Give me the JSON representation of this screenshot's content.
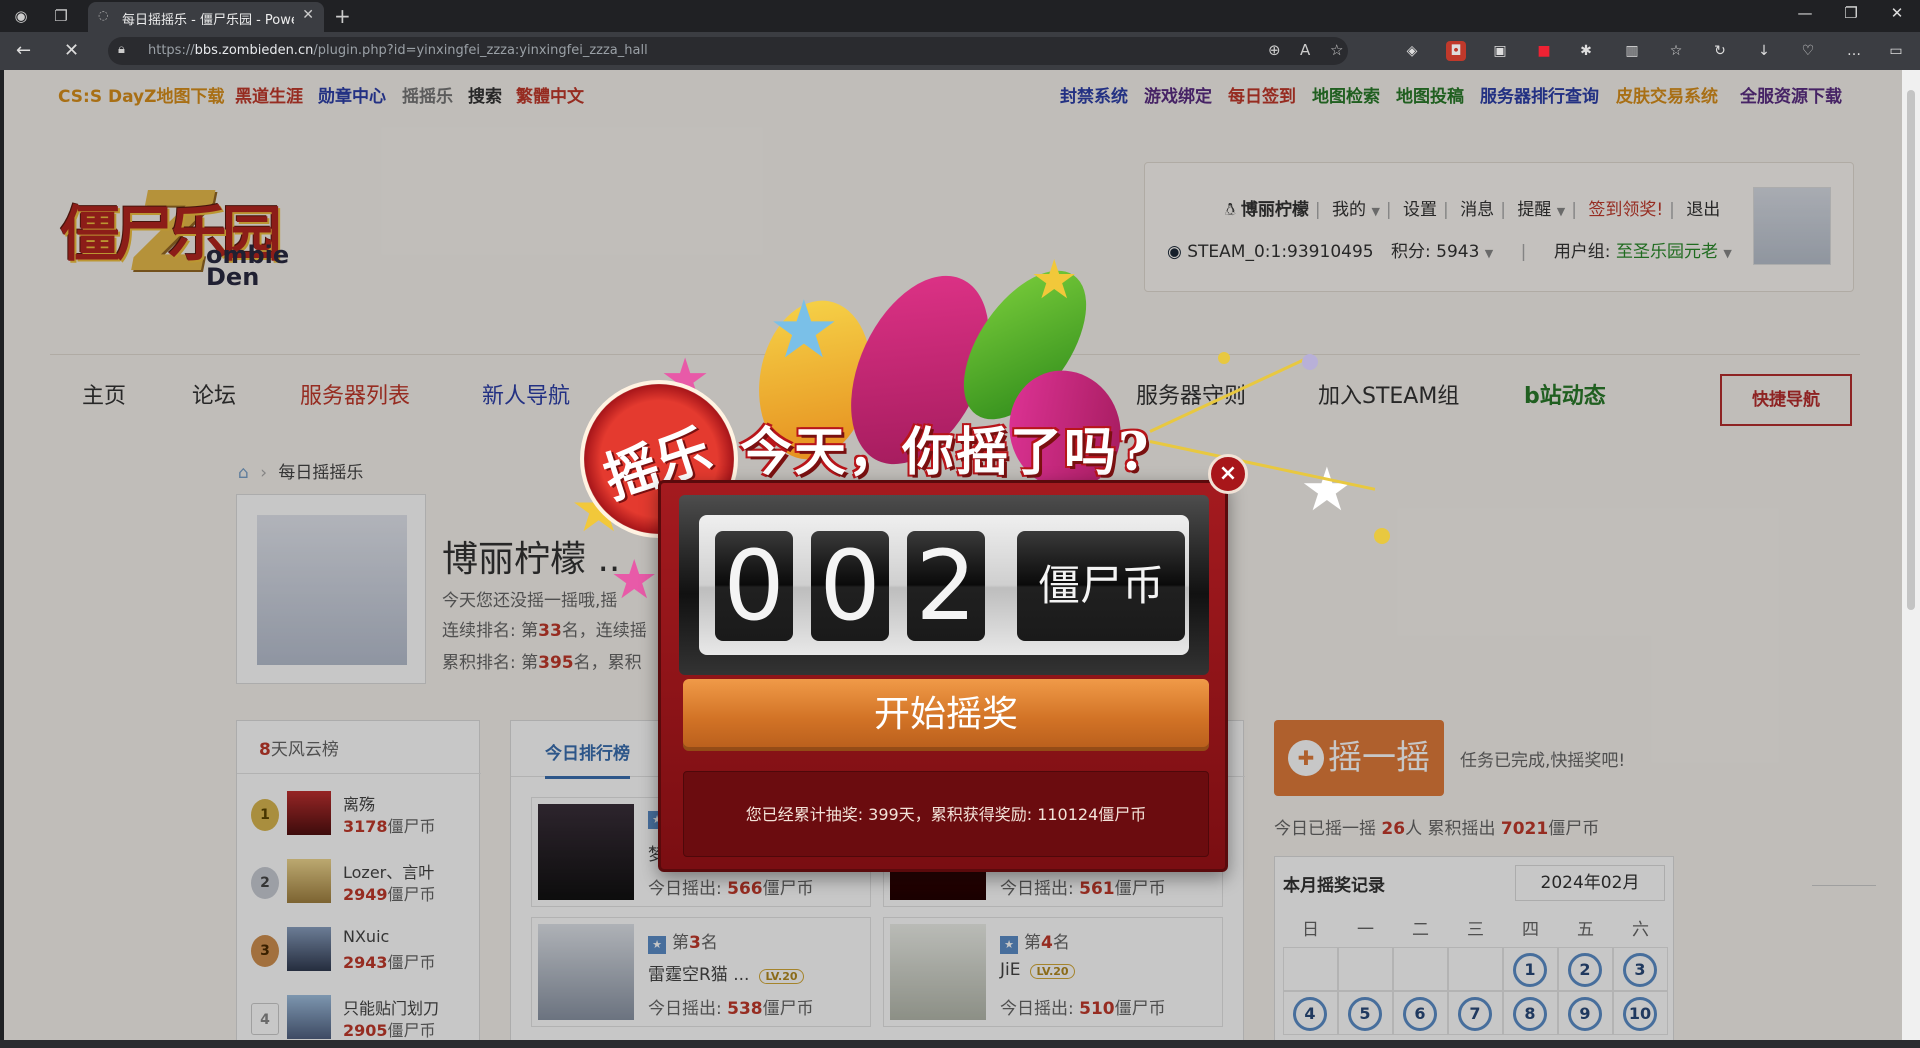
{
  "browser": {
    "tab_title": "每日摇摇乐 - 僵尸乐园 - Powere",
    "url_prefix": "https://",
    "url_domain": "bbs.zombieden.cn",
    "url_path": "/plugin.php?id=yinxingfei_zzza:yinxingfei_zzza_hall"
  },
  "topnav": {
    "left": [
      {
        "label": "CS:S DayZ地图下载",
        "color": "#d88f1b"
      },
      {
        "label": "黑道生涯",
        "color": "#c0392b"
      },
      {
        "label": "勋章中心",
        "color": "#2d3fa8"
      },
      {
        "label": "摇摇乐",
        "color": "#777777"
      },
      {
        "label": "搜索",
        "color": "#333333"
      },
      {
        "label": "繁體中文",
        "color": "#c0392b"
      }
    ],
    "right": [
      {
        "label": "封禁系统",
        "color": "#2d3fa8"
      },
      {
        "label": "游戏绑定",
        "color": "#5a2d82"
      },
      {
        "label": "每日签到",
        "color": "#c0392b"
      },
      {
        "label": "地图检索",
        "color": "#2a7a2a"
      },
      {
        "label": "地图投稿",
        "color": "#2a7a2a"
      },
      {
        "label": "服务器排行查询",
        "color": "#2d3fa8"
      },
      {
        "label": "皮肤交易系统",
        "color": "#d88f1b"
      },
      {
        "label": "全服资源下载",
        "color": "#5a2d82"
      }
    ]
  },
  "logo": {
    "cn": "僵尸乐园",
    "z": "Z",
    "en_line1": "ombie",
    "en_line2": "Den"
  },
  "user": {
    "name": "博丽柠檬",
    "my": "我的",
    "settings": "设置",
    "messages": "消息",
    "remind": "提醒",
    "signin": "签到领奖!",
    "logout": "退出",
    "steam_id": "STEAM_0:1:93910495",
    "points_label": "积分:",
    "points": "5943",
    "group_label": "用户组:",
    "group": "至圣乐园元老"
  },
  "mainnav": {
    "items": [
      {
        "label": "主页",
        "color": "#333333"
      },
      {
        "label": "论坛",
        "color": "#333333"
      },
      {
        "label": "服务器列表",
        "color": "#c0392b"
      },
      {
        "label": "新人导航",
        "color": "#2d3fa8"
      },
      {
        "label": "服务器守则",
        "color": "#333333"
      },
      {
        "label": "加入STEAM组",
        "color": "#333333"
      },
      {
        "label": "b站动态",
        "color": "#2a7a2a"
      }
    ],
    "quick_nav": "快捷导航"
  },
  "breadcrumb": {
    "current": "每日摇摇乐"
  },
  "profile": {
    "name": "博丽柠檬 ..",
    "line1": "今天您还没摇一摇哦,摇",
    "line2_prefix": "连续排名: 第",
    "line2_num": "33",
    "line2_suffix": "名，连续摇",
    "line3_prefix": "累积排名: 第",
    "line3_num": "395",
    "line3_suffix": "名，累积"
  },
  "leaderboard": {
    "title_num": "8",
    "title_rest": "天风云榜",
    "items": [
      {
        "rank": "1",
        "name": "离殇",
        "value": "3178",
        "unit": "僵尸币"
      },
      {
        "rank": "2",
        "name": "Lozer、言叶",
        "value": "2949",
        "unit": "僵尸币"
      },
      {
        "rank": "3",
        "name": "NXuic",
        "value": "2943",
        "unit": "僵尸币"
      },
      {
        "rank": "4",
        "name": "只能贴门划刀",
        "value": "2905",
        "unit": "僵尸币"
      }
    ]
  },
  "today": {
    "tab": "今日排行榜",
    "out_label": "今日摇出:",
    "unit": "僵尸币",
    "rank_prefix": "第",
    "rank_suffix": "名",
    "winners": [
      {
        "rank": "",
        "name": "梦",
        "value": "566",
        "lv": ""
      },
      {
        "rank": "",
        "name": "",
        "value": "561",
        "lv": ""
      },
      {
        "rank": "3",
        "name": "雷霆空R猫 ...",
        "value": "538",
        "lv": "LV.20"
      },
      {
        "rank": "4",
        "name": "JiE",
        "value": "510",
        "lv": "LV.20"
      }
    ]
  },
  "shake": {
    "button": "摇一摇",
    "tip": "任务已完成,快摇奖吧!",
    "today_prefix": "今日已摇一摇",
    "today_people": "26",
    "today_mid": "人 累积摇出",
    "today_total": "7021",
    "today_unit": "僵尸币"
  },
  "calendar": {
    "title": "本月摇奖记录",
    "month": "2024年02月",
    "weekdays": [
      "日",
      "一",
      "二",
      "三",
      "四",
      "五",
      "六"
    ],
    "row1": [
      "",
      "",
      "",
      "",
      "1",
      "2",
      "3"
    ],
    "row2": [
      "4",
      "5",
      "6",
      "7",
      "8",
      "9",
      "10"
    ]
  },
  "popup": {
    "seal": "摇乐",
    "headline": "今天，你摇了吗?",
    "digits": [
      "0",
      "0",
      "2"
    ],
    "unit": "僵尸币",
    "start": "开始摇奖",
    "stats": "您已经累计抽奖: 399天，累积获得奖励: 110124僵尸币",
    "close": "×"
  }
}
